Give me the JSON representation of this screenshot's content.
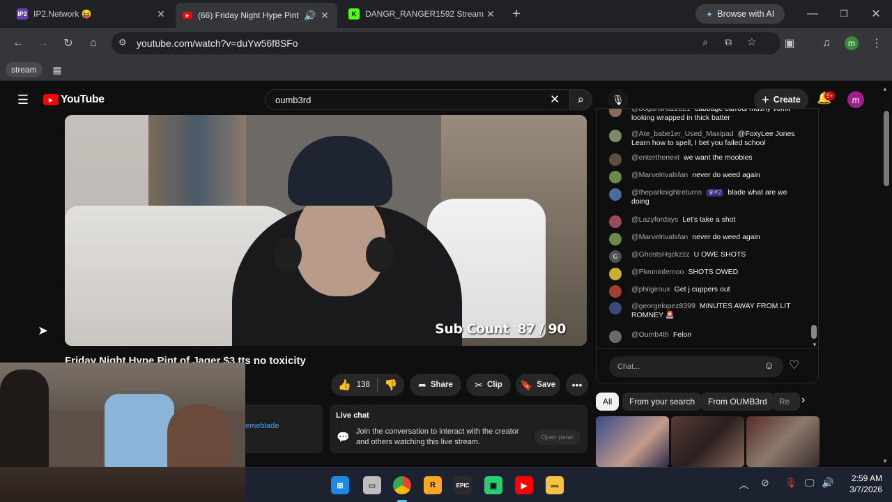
{
  "browser": {
    "tabs": [
      {
        "title": "IP2.Network 😝",
        "favicon": "IP2",
        "color": "#6b3fb5"
      },
      {
        "title": "(66) Friday Night Hype Pint",
        "favicon": "yt",
        "color": "#ff0000"
      },
      {
        "title": "DANGR_RANGER1592 Stream -",
        "favicon": "K",
        "color": "#53fc18"
      }
    ],
    "ai_button": "Browse with AI",
    "url": "youtube.com/watch?v=duYw56f8SFo",
    "bookmark": "stream",
    "profile_initial": "m"
  },
  "youtube": {
    "logo_text": "YouTube",
    "search_value": "oumb3rd",
    "create_label": "Create",
    "notif_count": "9+",
    "avatar_initial": "m",
    "video_overlay": "Sub Count  87 / 90",
    "video_title": "Friday Night Hype Pint of Jager $3 tts no toxicity",
    "likes": "138",
    "share_label": "Share",
    "clip_label": "Clip",
    "save_label": "Save",
    "partial_user": "emeblade",
    "live_chat_title": "Live chat",
    "live_chat_desc": "Join the conversation to interact with the creator and others watching this live stream.",
    "open_panel": "Open panel",
    "chat_placeholder": "Chat...",
    "chips": [
      "All",
      "From your search",
      "From OUMB3rd",
      "Re"
    ]
  },
  "chat_messages": [
    {
      "user": "@boganshazz821",
      "text": "cabbage carrots mushy vomit looking wrapped in thick batter",
      "avatar_color": "#8a6a5a"
    },
    {
      "user": "@Ate_babe1er_Used_Maxipad",
      "text": "@FoxyLee Jones Learn how to spell, I bet you failed school",
      "avatar_color": "#7a8a6a"
    },
    {
      "user": "@enterthenext",
      "text": "we want the moobies",
      "avatar_color": "#5a5040"
    },
    {
      "user": "@Marvelrivalsfan",
      "text": "never do weed again",
      "avatar_color": "#6a8a4a"
    },
    {
      "user": "@theparknightreturns",
      "badge": "#2",
      "text": "blade what are we doing",
      "avatar_color": "#4a6a9a"
    },
    {
      "user": "@Lazyfordays",
      "text": "Let's take a shot",
      "avatar_color": "#9a4a5a"
    },
    {
      "user": "@Marvelrivalsfan",
      "text": "never do weed again",
      "avatar_color": "#6a8a4a"
    },
    {
      "user": "@GhostsHqckzzz",
      "text": "U OWE SHOTS",
      "avatar_color": "#505050",
      "avatar_letter": "G"
    },
    {
      "user": "@Pkmninfernoo",
      "text": "SHOTS OWED",
      "avatar_color": "#c8b030"
    },
    {
      "user": "@philgiroux",
      "text": "Get j cuppers out",
      "avatar_color": "#a04030"
    },
    {
      "user": "@georgelopez8399",
      "text": "MINUTES AWAY FROM LIT ROMNEY 🚨",
      "avatar_color": "#3a4a7a"
    },
    {
      "user": "@Oumb4th",
      "text": "Felon",
      "avatar_color": "#6a6a6a"
    }
  ],
  "taskbar": {
    "time": "2:59 AM",
    "date": "3/7/2026"
  }
}
